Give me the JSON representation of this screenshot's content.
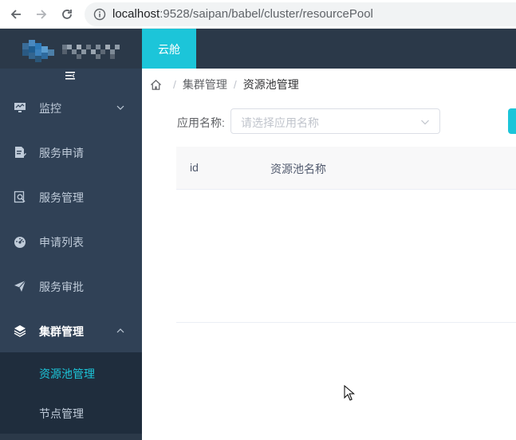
{
  "browser": {
    "url_host": "localhost",
    "url_rest": ":9528/saipan/babel/cluster/resourcePool"
  },
  "sidebar": {
    "items": [
      {
        "label": "监控",
        "icon": "monitor-icon",
        "has_children": true
      },
      {
        "label": "服务申请",
        "icon": "document-edit-icon"
      },
      {
        "label": "服务管理",
        "icon": "search-document-icon"
      },
      {
        "label": "申请列表",
        "icon": "dashboard-icon"
      },
      {
        "label": "服务审批",
        "icon": "send-icon"
      },
      {
        "label": "集群管理",
        "icon": "layers-icon",
        "has_children": true,
        "expanded": true
      }
    ],
    "subitems": [
      {
        "label": "资源池管理",
        "active": true
      },
      {
        "label": "节点管理",
        "active": false
      }
    ]
  },
  "header": {
    "active_tab": "云舱"
  },
  "breadcrumb": {
    "items": [
      "集群管理",
      "资源池管理"
    ]
  },
  "filter": {
    "label": "应用名称:",
    "placeholder": "请选择应用名称"
  },
  "table": {
    "columns": [
      "id",
      "资源池名称"
    ]
  },
  "colors": {
    "accent": "#1cc5d9",
    "sidebar_bg": "#304156",
    "header_bg": "#2b3949",
    "submenu_bg": "#1f2d3d"
  }
}
